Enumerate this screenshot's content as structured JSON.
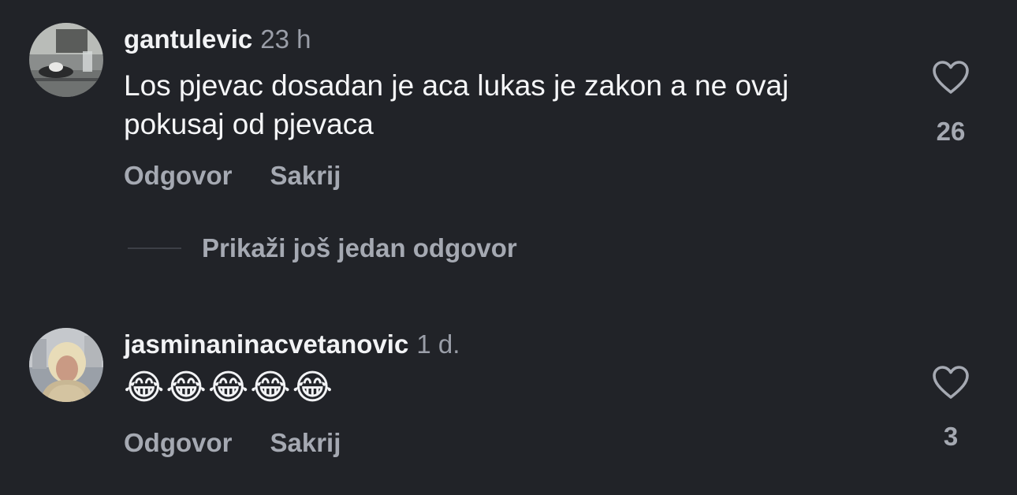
{
  "comments": [
    {
      "username": "gantulevic",
      "time": "23 h",
      "text": "Los pjevac  dosadan je aca lukas je zakon a ne ovaj pokusaj od pjevaca",
      "reply_label": "Odgovor",
      "hide_label": "Sakrij",
      "likes": "26",
      "avatar_icon": "cafe-table-photo"
    },
    {
      "username": "jasminaninacvetanovic",
      "time": "1 d.",
      "text": "😂😂😂😂😂",
      "reply_label": "Odgovor",
      "hide_label": "Sakrij",
      "likes": "3",
      "avatar_icon": "woman-portrait-photo"
    }
  ],
  "show_replies_label": "Prikaži još jedan odgovor",
  "icons": {
    "like": "heart-outline-icon"
  },
  "colors": {
    "background": "#212328",
    "primary_text": "#f2f3f5",
    "secondary_text": "#a5a9b2",
    "timestamp": "#9a9ea8"
  }
}
